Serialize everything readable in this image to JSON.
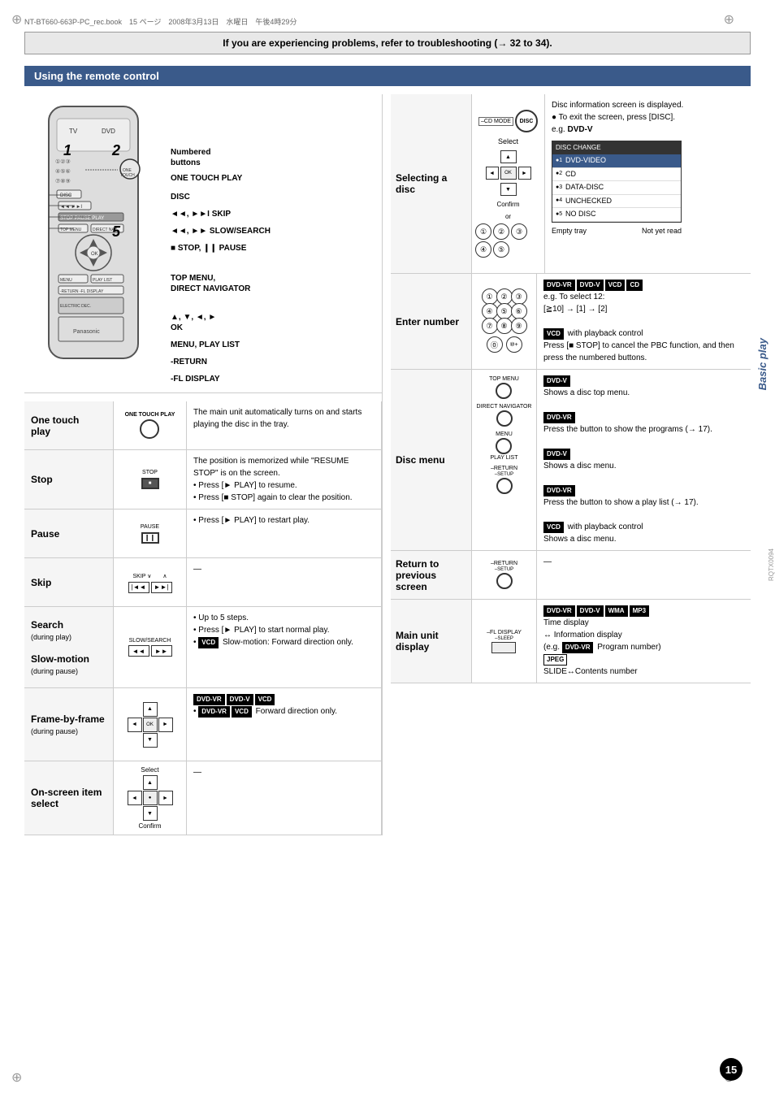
{
  "page": {
    "number": "15",
    "rotx": "RQTX0094",
    "top_meta": "NT-BT660-663P-PC_rec.book　15 ページ　2008年3月13日　水曜日　午後4時29分"
  },
  "header": {
    "text": "If you are experiencing problems, refer to troubleshooting (→ 32 to 34)."
  },
  "section": {
    "title": "Using the remote control"
  },
  "remote": {
    "steps": [
      "1",
      "2",
      "5"
    ],
    "labels": [
      {
        "name": "Numbered buttons",
        "desc": ""
      },
      {
        "name": "ONE TOUCH PLAY",
        "desc": ""
      },
      {
        "name": "DISC",
        "desc": ""
      },
      {
        "name": "◄◄, ►► SKIP",
        "desc": ""
      },
      {
        "name": "◄◄, ►► SLOW/SEARCH",
        "desc": ""
      },
      {
        "name": "■ STOP, ❙❙ PAUSE",
        "desc": ""
      },
      {
        "name": "TOP MENU, DIRECT NAVIGATOR",
        "desc": ""
      },
      {
        "name": "▲, ▼, ◄, ► OK",
        "desc": ""
      },
      {
        "name": "MENU, PLAY LIST",
        "desc": ""
      },
      {
        "name": "-RETURN",
        "desc": ""
      },
      {
        "name": "-FL DISPLAY",
        "desc": ""
      }
    ]
  },
  "features_left": [
    {
      "name": "One touch play",
      "icon_label": "ONE TOUCH PLAY",
      "desc": "The main unit automatically turns on and starts playing the disc in the tray."
    },
    {
      "name": "Stop",
      "icon_label": "STOP",
      "desc": "The position is memorized while \"RESUME STOP\" is on the screen.\n• Press [► PLAY] to resume.\n• Press [■ STOP] again to clear the position."
    },
    {
      "name": "Pause",
      "icon_label": "PAUSE",
      "desc": "• Press [► PLAY] to restart play."
    },
    {
      "name": "Skip",
      "icon_label": "SKIP",
      "desc": "—"
    },
    {
      "name": "Search",
      "sub": "(during play)",
      "name2": "Slow-motion",
      "sub2": "(during pause)",
      "icon_label": "SLOW/SEARCH",
      "desc": "• Up to 5 steps.\n• Press [► PLAY] to start normal play.\n• VCD Slow-motion: Forward direction only."
    },
    {
      "name": "Frame-by-frame",
      "sub": "(during pause)",
      "icon_label": "nav",
      "desc": "DVD-VR DVD-V VCD\n• DVD-VR VCD Forward direction only."
    },
    {
      "name": "On-screen item select",
      "icon_label": "nav2",
      "desc": "—"
    }
  ],
  "features_right": [
    {
      "name": "Selecting a disc",
      "icon_label": "disc_select",
      "desc_header": "Disc information screen is displayed.",
      "desc": "• To exit the screen, press [DISC].\ne.g. DVD-V",
      "disc_table": {
        "header": "DISC CHANGE",
        "rows": [
          {
            "num": "●1",
            "label": "DVD-VIDEO",
            "selected": true
          },
          {
            "num": "●2",
            "label": "CD",
            "selected": false
          },
          {
            "num": "●3",
            "label": "DATA-DISC",
            "selected": false
          },
          {
            "num": "●4",
            "label": "UNCHECKED",
            "selected": false
          },
          {
            "num": "●5",
            "label": "NO DISC",
            "selected": false
          }
        ],
        "footer_left": "Empty tray",
        "footer_right": "Not yet read"
      },
      "num_seq": [
        "①",
        "②",
        "③",
        "④",
        "⑤"
      ]
    },
    {
      "name": "Enter number",
      "icon_label": "numpad",
      "desc": "DVD-VR DVD-V VCD CD\ne.g. To select 12:\n[≧10] → [1] → [2]\nVCD with playback control\nPress [■ STOP] to cancel the PBC function, and then press the numbered buttons."
    },
    {
      "name": "Disc menu",
      "icon_label": "disc_menu",
      "desc": "DVD-V\nShows a disc top menu.\n\nDVD-VR\nPress the button to show the programs (→ 17).\n\nDVD-V\nShows a disc menu.\n\nDVD-VR\nPress the button to show a play list (→ 17).\n\nVCD with playback control\nShows a disc menu."
    },
    {
      "name": "Return to previous screen",
      "icon_label": "return_btn",
      "desc": "—"
    },
    {
      "name": "Main unit display",
      "icon_label": "display_btn",
      "desc": "DVD-VR DVD-V WMA MP3\nTime display\n↔ Information display\n(e.g. DVD-VR Program number)\nJPEG\nSLIDE↔Contents number"
    }
  ],
  "sidebar": {
    "text": "Basic play"
  }
}
